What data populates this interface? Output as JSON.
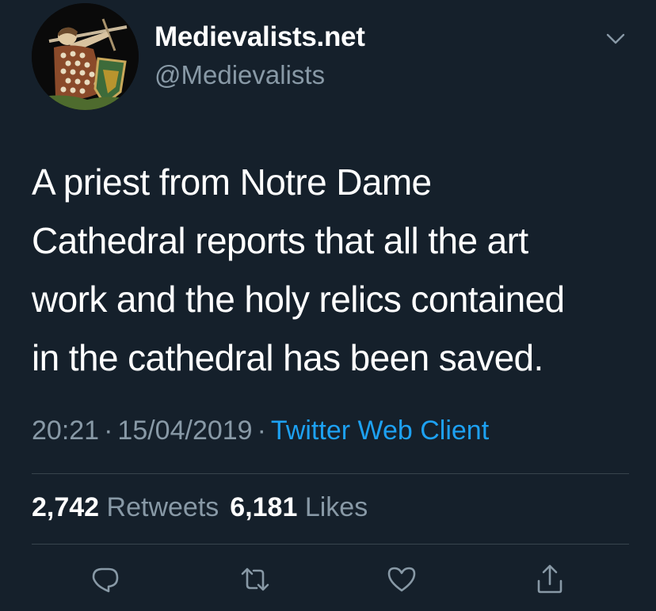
{
  "profile": {
    "display_name": "Medievalists.net",
    "handle": "@Medievalists",
    "avatar_icon": "medieval-tapestry-figure-avatar"
  },
  "tweet": {
    "text": "A priest from Notre Dame\nCathedral reports that all the art\nwork and the holy relics contained\nin the cathedral has been saved."
  },
  "meta": {
    "time": "20:21",
    "separator": "·",
    "date": "15/04/2019",
    "source": "Twitter Web Client"
  },
  "stats": {
    "retweets_count": "2,742",
    "retweets_label": "Retweets",
    "likes_count": "6,181",
    "likes_label": "Likes"
  },
  "actions": {
    "icons": [
      "reply-icon",
      "retweet-icon",
      "like-icon",
      "share-icon"
    ]
  },
  "colors": {
    "background": "#15202b",
    "text": "#ffffff",
    "secondary_text": "#8899a6",
    "link": "#1da1f2",
    "divider": "#38444d"
  }
}
